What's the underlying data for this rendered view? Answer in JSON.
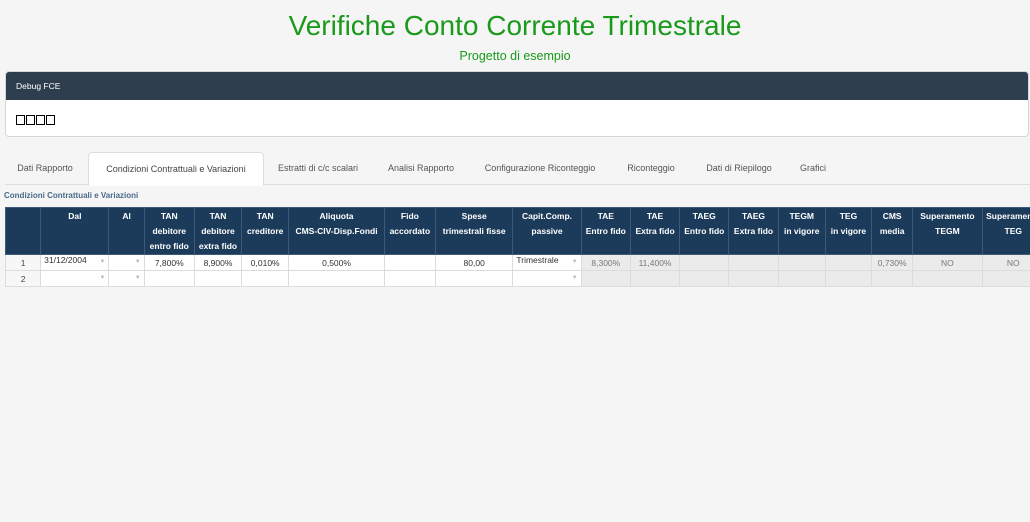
{
  "header": {
    "title": "Verifiche Conto Corrente Trimestrale",
    "subtitle": "Progetto di esempio"
  },
  "debug": {
    "title": "Debug FCE",
    "glyphs": "□□□□"
  },
  "tabs": [
    {
      "label": "Dati Rapporto",
      "active": false
    },
    {
      "label": "Condizioni Contrattuali e Variazioni",
      "active": true
    },
    {
      "label": "Estratti di c/c scalari",
      "active": false
    },
    {
      "label": "Analisi Rapporto",
      "active": false
    },
    {
      "label": "Configurazione Riconteggio",
      "active": false
    },
    {
      "label": "Riconteggio",
      "active": false
    },
    {
      "label": "Dati di Riepilogo",
      "active": false
    },
    {
      "label": "Grafici",
      "active": false
    }
  ],
  "section": {
    "label": "Condizioni Contrattuali e Variazioni"
  },
  "table": {
    "columns": [
      {
        "l1": "",
        "l2": "",
        "l3": ""
      },
      {
        "l1": "Dal",
        "l2": "",
        "l3": ""
      },
      {
        "l1": "Al",
        "l2": "",
        "l3": ""
      },
      {
        "l1": "TAN",
        "l2": "debitore",
        "l3": "entro fido"
      },
      {
        "l1": "TAN",
        "l2": "debitore",
        "l3": "extra fido"
      },
      {
        "l1": "TAN",
        "l2": "creditore",
        "l3": ""
      },
      {
        "l1": "Aliquota",
        "l2": "CMS-CIV-Disp.Fondi",
        "l3": ""
      },
      {
        "l1": "Fido",
        "l2": "accordato",
        "l3": ""
      },
      {
        "l1": "Spese",
        "l2": "trimestrali fisse",
        "l3": ""
      },
      {
        "l1": "Capit.Comp.",
        "l2": "passive",
        "l3": ""
      },
      {
        "l1": "TAE",
        "l2": "Entro fido",
        "l3": ""
      },
      {
        "l1": "TAE",
        "l2": "Extra fido",
        "l3": ""
      },
      {
        "l1": "TAEG",
        "l2": "Entro fido",
        "l3": ""
      },
      {
        "l1": "TAEG",
        "l2": "Extra fido",
        "l3": ""
      },
      {
        "l1": "TEGM",
        "l2": "in vigore",
        "l3": ""
      },
      {
        "l1": "TEG",
        "l2": "in vigore",
        "l3": ""
      },
      {
        "l1": "CMS",
        "l2": "media",
        "l3": ""
      },
      {
        "l1": "Superamento",
        "l2": "TEGM",
        "l3": ""
      },
      {
        "l1": "Superamento",
        "l2": "TEG",
        "l3": ""
      }
    ],
    "rows": [
      {
        "num": "1",
        "dal": "31/12/2004",
        "al": "",
        "tan_deb_entro": "7,800%",
        "tan_deb_extra": "8,900%",
        "tan_cred": "0,010%",
        "aliquota": "0,500%",
        "fido": "",
        "spese": "80,00",
        "capit": "Trimestrale",
        "tae_entro": "8,300%",
        "tae_extra": "11,400%",
        "taeg_entro": "",
        "taeg_extra": "",
        "tegm": "",
        "teg": "",
        "cms": "0,730%",
        "sup_tegm": "NO",
        "sup_teg": "NO"
      },
      {
        "num": "2",
        "dal": "",
        "al": "",
        "tan_deb_entro": "",
        "tan_deb_extra": "",
        "tan_cred": "",
        "aliquota": "",
        "fido": "",
        "spese": "",
        "capit": "",
        "tae_entro": "",
        "tae_extra": "",
        "taeg_entro": "",
        "taeg_extra": "",
        "tegm": "",
        "teg": "",
        "cms": "",
        "sup_tegm": "",
        "sup_teg": ""
      }
    ]
  },
  "colors": {
    "title": "#1a9a1a",
    "panel_header": "#2e3e4e",
    "table_header": "#1c3b5a"
  }
}
